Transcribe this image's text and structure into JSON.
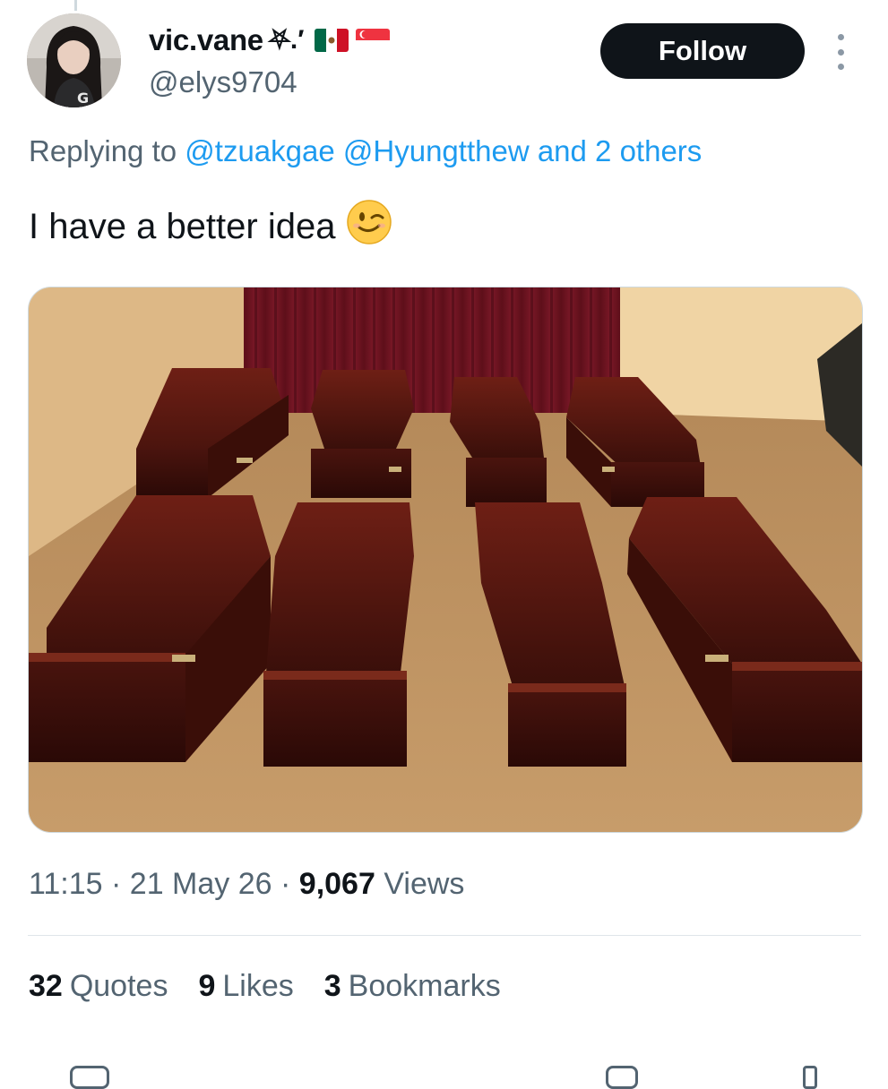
{
  "author": {
    "display_name": "vic.vane",
    "name_decoration": "⛧.′",
    "flags": [
      "mexico-flag",
      "singapore-flag"
    ],
    "handle": "@elys9704",
    "avatar_icon": "profile-photo"
  },
  "follow_label": "Follow",
  "more_icon": "more-options-icon",
  "reply": {
    "prefix": "Replying to",
    "mentions": [
      "@tzuakgae",
      "@Hyungtthew"
    ],
    "suffix": "and 2 others"
  },
  "tweet": {
    "text": "I have a better idea",
    "emoji": "winking-face"
  },
  "media": {
    "kind": "photo",
    "subject": "eight-coffins-room"
  },
  "meta": {
    "time": "11:15",
    "sep1": "·",
    "date": "21 May 26",
    "sep2": "·",
    "views_count": "9,067",
    "views_label": "Views"
  },
  "stats": [
    {
      "count": "32",
      "label": "Quotes"
    },
    {
      "count": "9",
      "label": "Likes"
    },
    {
      "count": "3",
      "label": "Bookmarks"
    }
  ],
  "colors": {
    "text": "#0f1419",
    "muted": "#536471",
    "link": "#1d9bf0",
    "button_bg": "#0f1419",
    "divider": "#dfe5e9"
  }
}
